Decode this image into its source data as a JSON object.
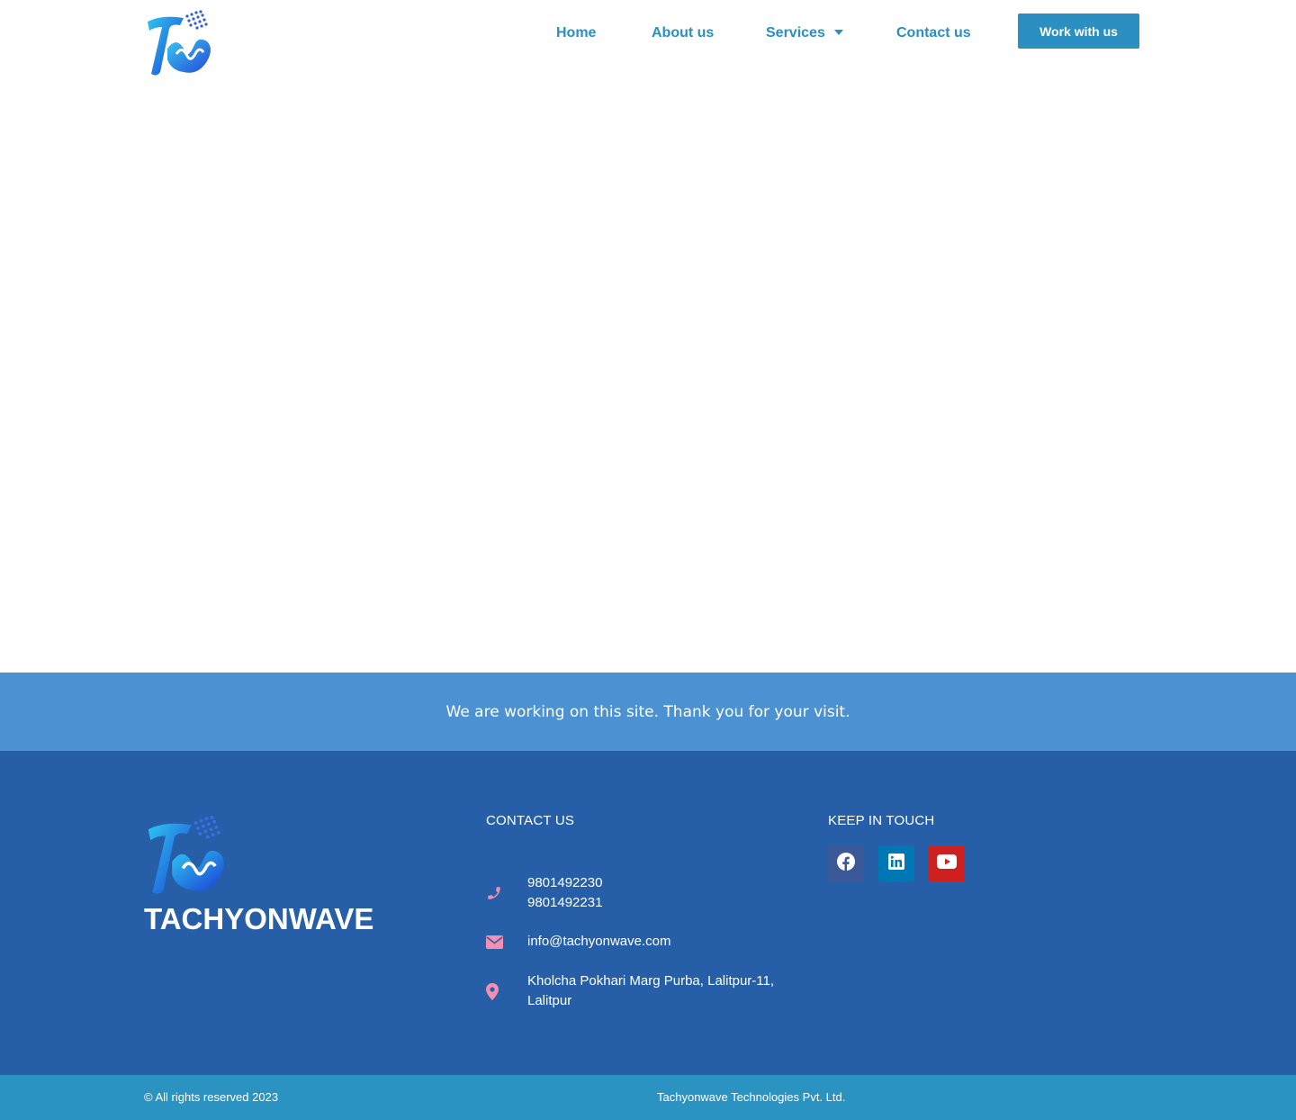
{
  "header": {
    "nav": {
      "home": "Home",
      "about": "About us",
      "services": "Services",
      "contact": "Contact us"
    },
    "cta_label": "Work with us"
  },
  "notice": {
    "text": "We are working on this site. Thank you for your visit."
  },
  "footer": {
    "brand_name": "TACHYONWAVE",
    "contact_heading": "CONTACT US",
    "phones": [
      "9801492230",
      "9801492231"
    ],
    "email": "info@tachyonwave.com",
    "address_line1": "Kholcha Pokhari Marg Purba, Lalitpur-11,",
    "address_line2": "Lalitpur",
    "keep_in_touch_heading": "KEEP IN TOUCH",
    "social": [
      {
        "icon": "facebook-icon",
        "color": "#3b5998"
      },
      {
        "icon": "linkedin-icon",
        "color": "#0077b5"
      },
      {
        "icon": "youtube-icon",
        "color": "#cd201f"
      }
    ]
  },
  "bottom_bar": {
    "copyright": "© All rights reserved 2023",
    "company": "Tachyonwave Technologies Pvt. Ltd."
  },
  "colors": {
    "accent": "#2b8fc1",
    "notice_bg": "#4c91d1",
    "footer_bg": "#265fa7",
    "bottom_bg": "#2b93c2",
    "contact_icon": "#f48fb1"
  }
}
